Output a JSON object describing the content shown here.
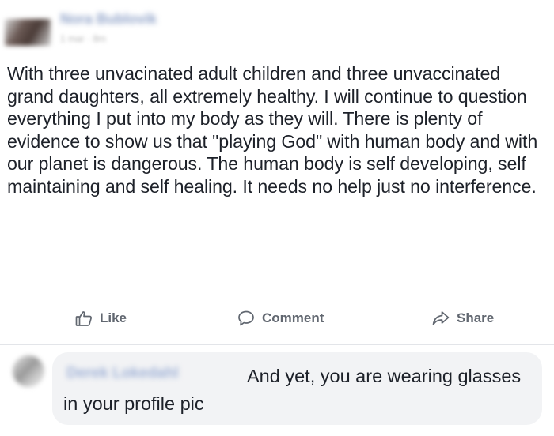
{
  "post": {
    "author": "Nora Bublovik",
    "meta": "1 mar · 8m",
    "body": "With three unvacinated adult children and three unvaccinated grand daughters, all extremely healthy. I will continue to question everything I put into my body as they will. There is plenty of evidence to show us that \"playing God\" with human body and with our planet is dangerous. The human body is self developing, self maintaining and self healing. It needs no help just no interference."
  },
  "actions": {
    "like_label": "Like",
    "comment_label": "Comment",
    "share_label": "Share",
    "like_icon": "thumbs-up-icon",
    "comment_icon": "speech-bubble-icon",
    "share_icon": "share-arrow-icon"
  },
  "comment": {
    "author": "Derek Lokedahl",
    "text": "And yet, you are wearing glasses in your profile pic"
  },
  "colors": {
    "body_text": "#1d2129",
    "action_text": "#616770",
    "bubble_bg": "#f2f3f5",
    "name_link": "#8fa2c8"
  }
}
